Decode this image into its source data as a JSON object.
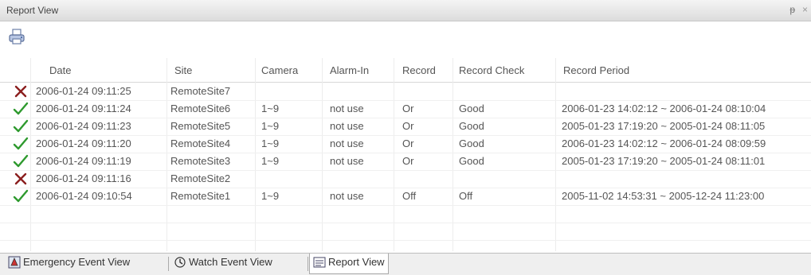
{
  "window": {
    "title": "Report View",
    "pin_glyph": "ᵽ",
    "close_glyph": "×"
  },
  "toolbar": {
    "print_icon": "printer-icon"
  },
  "table": {
    "columns": [
      "Date",
      "Site",
      "Camera",
      "Alarm-In",
      "Record",
      "Record Check",
      "Record Period"
    ],
    "rows": [
      {
        "status": "fail",
        "date": "2006-01-24  09:11:25",
        "site": "RemoteSite7",
        "camera": "",
        "alarm_in": "",
        "record": "",
        "record_check": "",
        "record_period": ""
      },
      {
        "status": "ok",
        "date": "2006-01-24  09:11:24",
        "site": "RemoteSite6",
        "camera": "1~9",
        "alarm_in": "not use",
        "record": "Or",
        "record_check": "Good",
        "record_period": "2006-01-23 14:02:12 ~ 2006-01-24 08:10:04"
      },
      {
        "status": "ok",
        "date": "2006-01-24  09:11:23",
        "site": "RemoteSite5",
        "camera": "1~9",
        "alarm_in": "not use",
        "record": "Or",
        "record_check": "Good",
        "record_period": "2005-01-23 17:19:20 ~ 2005-01-24 08:11:05"
      },
      {
        "status": "ok",
        "date": "2006-01-24  09:11:20",
        "site": "RemoteSite4",
        "camera": "1~9",
        "alarm_in": "not use",
        "record": "Or",
        "record_check": "Good",
        "record_period": "2006-01-23 14:02:12 ~ 2006-01-24 08:09:59"
      },
      {
        "status": "ok",
        "date": "2006-01-24  09:11:19",
        "site": "RemoteSite3",
        "camera": "1~9",
        "alarm_in": "not use",
        "record": "Or",
        "record_check": "Good",
        "record_period": "2005-01-23 17:19:20 ~ 2005-01-24 08:11:01"
      },
      {
        "status": "fail",
        "date": "2006-01-24  09:11:16",
        "site": "RemoteSite2",
        "camera": "",
        "alarm_in": "",
        "record": "",
        "record_check": "",
        "record_period": ""
      },
      {
        "status": "ok",
        "date": "2006-01-24  09:10:54",
        "site": "RemoteSite1",
        "camera": "1~9",
        "alarm_in": "not use",
        "record": "Off",
        "record_check": "Off",
        "record_period": "2005-11-02 14:53:31 ~ 2005-12-24 11:23:00"
      }
    ],
    "status_colors": {
      "ok": "#2e9a2e",
      "fail": "#8b1e1e"
    }
  },
  "tabs": [
    {
      "label": "Emergency Event View",
      "icon": "emergency-icon",
      "active": false
    },
    {
      "label": "Watch Event View",
      "icon": "watch-icon",
      "active": false
    },
    {
      "label": "Report View",
      "icon": "report-icon",
      "active": true
    }
  ]
}
